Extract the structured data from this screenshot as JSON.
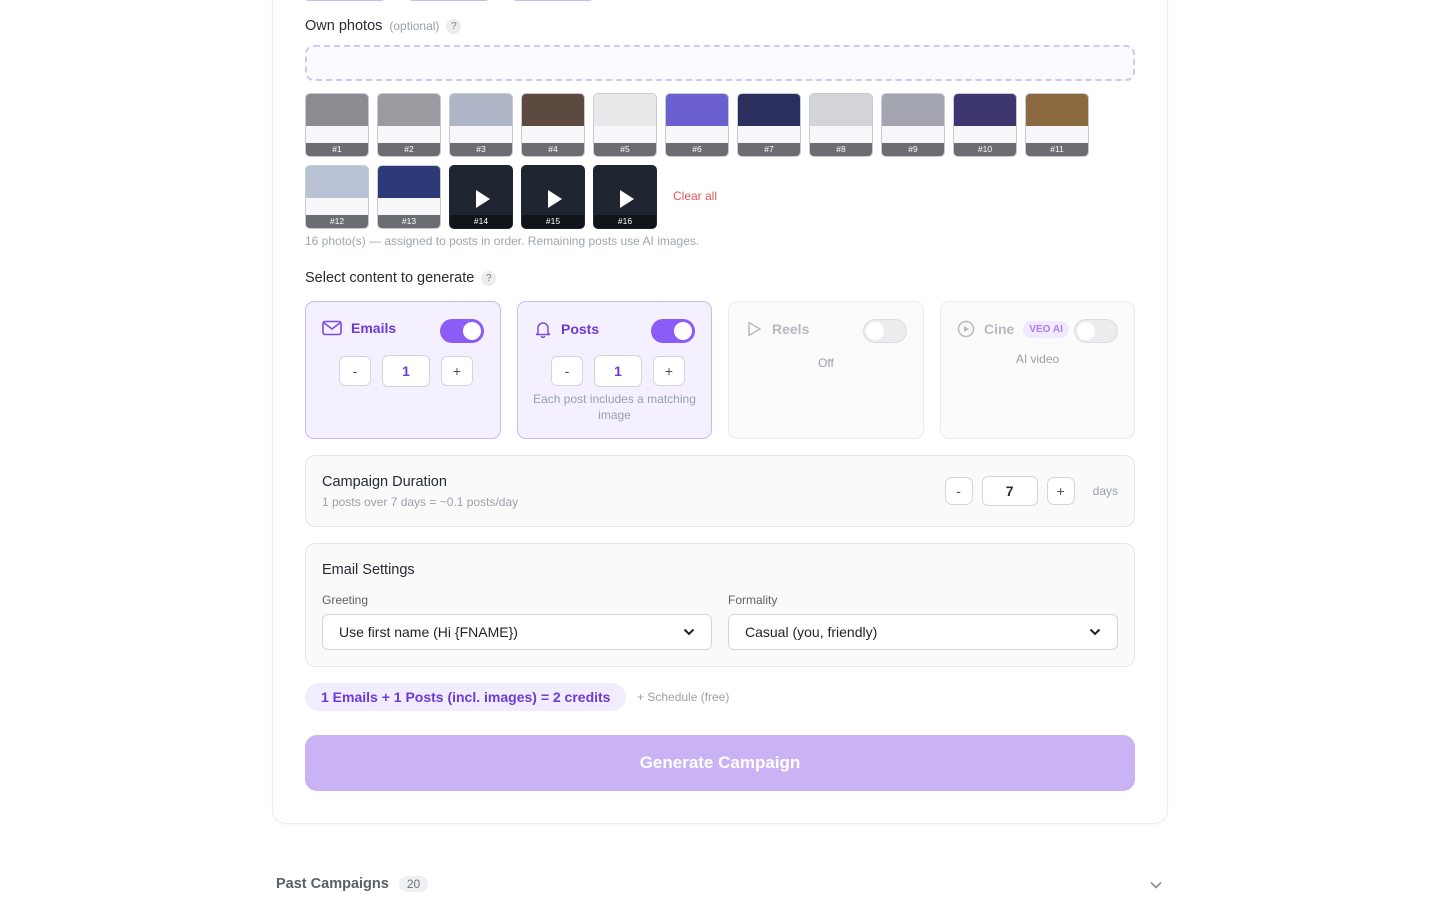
{
  "photos": {
    "label": "Own photos",
    "optional": "(optional)",
    "help": "?",
    "clear_all": "Clear all",
    "hint": "16 photo(s) — assigned to posts in order. Remaining posts use AI images.",
    "thumbs": [
      {
        "num": "#1",
        "tone": "#8b8c92"
      },
      {
        "num": "#2",
        "tone": "#9a9ba0"
      },
      {
        "num": "#3",
        "tone": "#aeb5c6"
      },
      {
        "num": "#4",
        "tone": "#5c4a40"
      },
      {
        "num": "#5",
        "tone": "#e9e9ec"
      },
      {
        "num": "#6",
        "tone": "#6c5fd0"
      },
      {
        "num": "#7",
        "tone": "#2b2f5e"
      },
      {
        "num": "#8",
        "tone": "#d3d4d8"
      },
      {
        "num": "#9",
        "tone": "#a3a6b0"
      },
      {
        "num": "#10",
        "tone": "#3d3770"
      },
      {
        "num": "#11",
        "tone": "#8a6a3e"
      },
      {
        "num": "#12",
        "tone": "#b8c2d4"
      },
      {
        "num": "#13",
        "tone": "#2e3a78"
      },
      {
        "num": "#14",
        "tone": "video"
      },
      {
        "num": "#15",
        "tone": "video"
      },
      {
        "num": "#16",
        "tone": "video"
      }
    ]
  },
  "content": {
    "label": "Select content to generate",
    "help": "?",
    "emails": {
      "name": "Emails",
      "minus": "-",
      "value": "1",
      "plus": "+",
      "enabled": true
    },
    "posts": {
      "name": "Posts",
      "minus": "-",
      "value": "1",
      "plus": "+",
      "note": "Each post includes a matching image",
      "enabled": true
    },
    "reels": {
      "name": "Reels",
      "status": "Off",
      "enabled": false
    },
    "cine": {
      "name": "Cine",
      "badge": "VEO AI",
      "status": "AI video",
      "enabled": false
    }
  },
  "duration": {
    "title": "Campaign Duration",
    "summary": "1 posts over 7 days = ~0.1 posts/day",
    "minus": "-",
    "value": "7",
    "plus": "+",
    "unit": "days"
  },
  "email_settings": {
    "title": "Email Settings",
    "greeting_label": "Greeting",
    "greeting_value": "Use first name (Hi {FNAME})",
    "formality_label": "Formality",
    "formality_value": "Casual (you, friendly)"
  },
  "summary": {
    "credits": "1 Emails + 1 Posts (incl. images) = 2 credits",
    "schedule": "+ Schedule (free)"
  },
  "generate_label": "Generate Campaign",
  "past": {
    "title": "Past Campaigns",
    "count": "20"
  },
  "colors": {
    "accent": "#8b5cf6",
    "accent_text": "#6d3bd4",
    "button_disabled": "#c9b3f5",
    "danger": "#e0584f"
  }
}
